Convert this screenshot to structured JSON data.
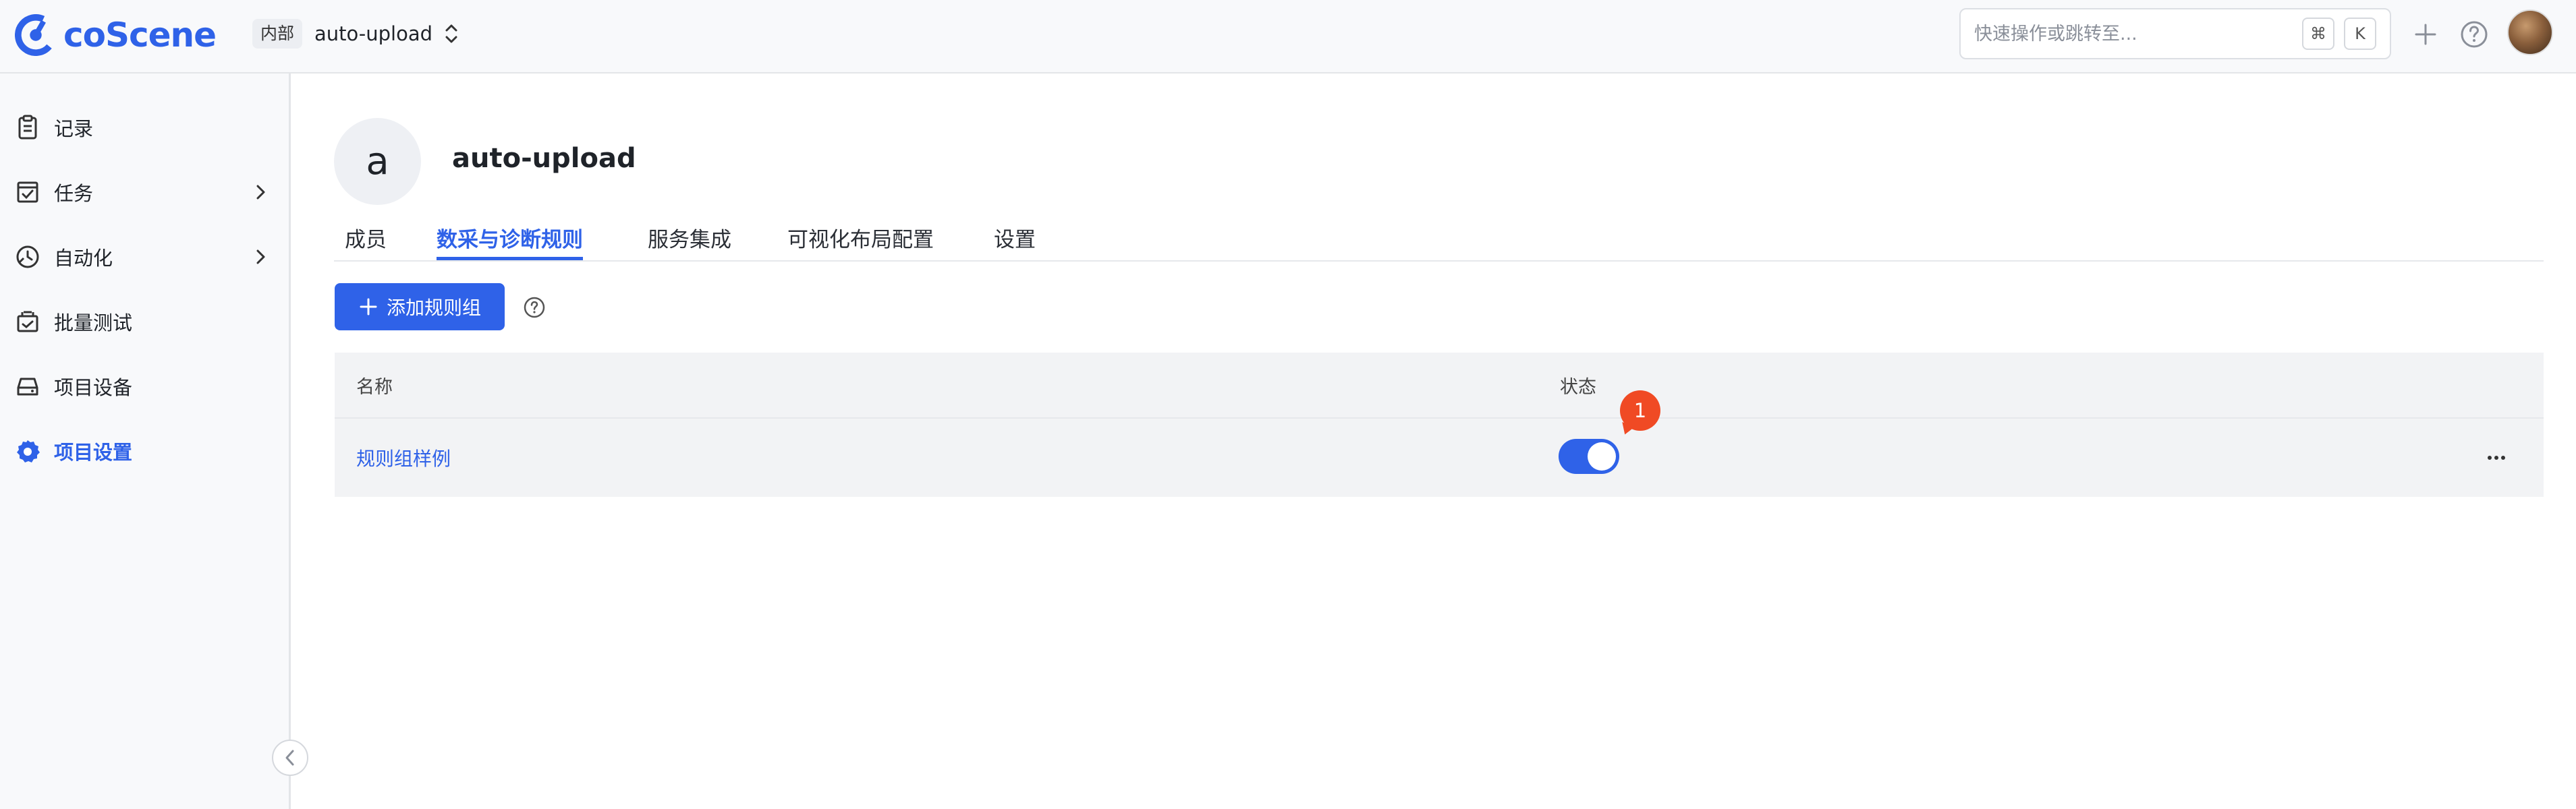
{
  "header": {
    "logo_text": "coScene",
    "env_badge": "内部",
    "project_name": "auto-upload",
    "search": {
      "placeholder": "快速操作或跳转至...",
      "value": ""
    },
    "shortcut_keys": [
      "⌘",
      "K"
    ]
  },
  "sidebar": {
    "items": [
      {
        "label": "记录",
        "icon": "clipboard-icon",
        "has_submenu": false,
        "active": false
      },
      {
        "label": "任务",
        "icon": "task-check-icon",
        "has_submenu": true,
        "active": false
      },
      {
        "label": "自动化",
        "icon": "automation-icon",
        "has_submenu": true,
        "active": false
      },
      {
        "label": "批量测试",
        "icon": "batch-test-icon",
        "has_submenu": false,
        "active": false
      },
      {
        "label": "项目设备",
        "icon": "device-icon",
        "has_submenu": false,
        "active": false
      },
      {
        "label": "项目设置",
        "icon": "gear-icon",
        "has_submenu": false,
        "active": true
      }
    ]
  },
  "project": {
    "avatar_letter": "a",
    "title": "auto-upload"
  },
  "tabs": [
    {
      "label": "成员",
      "active": false
    },
    {
      "label": "数采与诊断规则",
      "active": true
    },
    {
      "label": "服务集成",
      "active": false
    },
    {
      "label": "可视化布局配置",
      "active": false
    },
    {
      "label": "设置",
      "active": false
    }
  ],
  "actions": {
    "add_rule_group": "添加规则组"
  },
  "table": {
    "columns": [
      "名称",
      "状态"
    ],
    "rows": [
      {
        "name": "规则组样例",
        "enabled": true,
        "badge": "1"
      }
    ]
  },
  "colors": {
    "accent": "#2f62e8",
    "badge": "#f04a24",
    "table_bg": "#f2f3f5"
  }
}
